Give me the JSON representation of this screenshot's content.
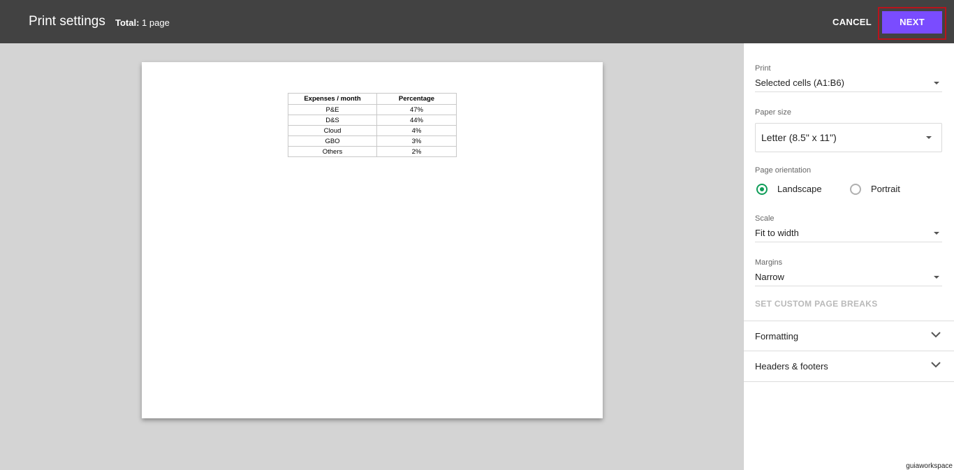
{
  "header": {
    "title": "Print settings",
    "total_label": "Total:",
    "total_value": "1 page",
    "cancel_label": "CANCEL",
    "next_label": "NEXT"
  },
  "preview": {
    "table": {
      "headers": [
        "Expenses / month",
        "Percentage"
      ],
      "rows": [
        [
          "P&E",
          "47%"
        ],
        [
          "D&S",
          "44%"
        ],
        [
          "Cloud",
          "4%"
        ],
        [
          "GBO",
          "3%"
        ],
        [
          "Others",
          "2%"
        ]
      ]
    }
  },
  "panel": {
    "print": {
      "label": "Print",
      "value": "Selected cells (A1:B6)"
    },
    "paper_size": {
      "label": "Paper size",
      "value": "Letter (8.5\" x 11\")"
    },
    "orientation": {
      "label": "Page orientation",
      "options": [
        "Landscape",
        "Portrait"
      ],
      "selected": "Landscape"
    },
    "scale": {
      "label": "Scale",
      "value": "Fit to width"
    },
    "margins": {
      "label": "Margins",
      "value": "Narrow"
    },
    "custom_breaks": "SET CUSTOM PAGE BREAKS",
    "sections": [
      "Formatting",
      "Headers & footers"
    ]
  },
  "colors": {
    "topbar": "#424242",
    "next_button": "#7a4cff",
    "highlight_outline": "#b8141c",
    "radio_selected": "#0f9d58"
  },
  "watermark": "guiaworkspace"
}
